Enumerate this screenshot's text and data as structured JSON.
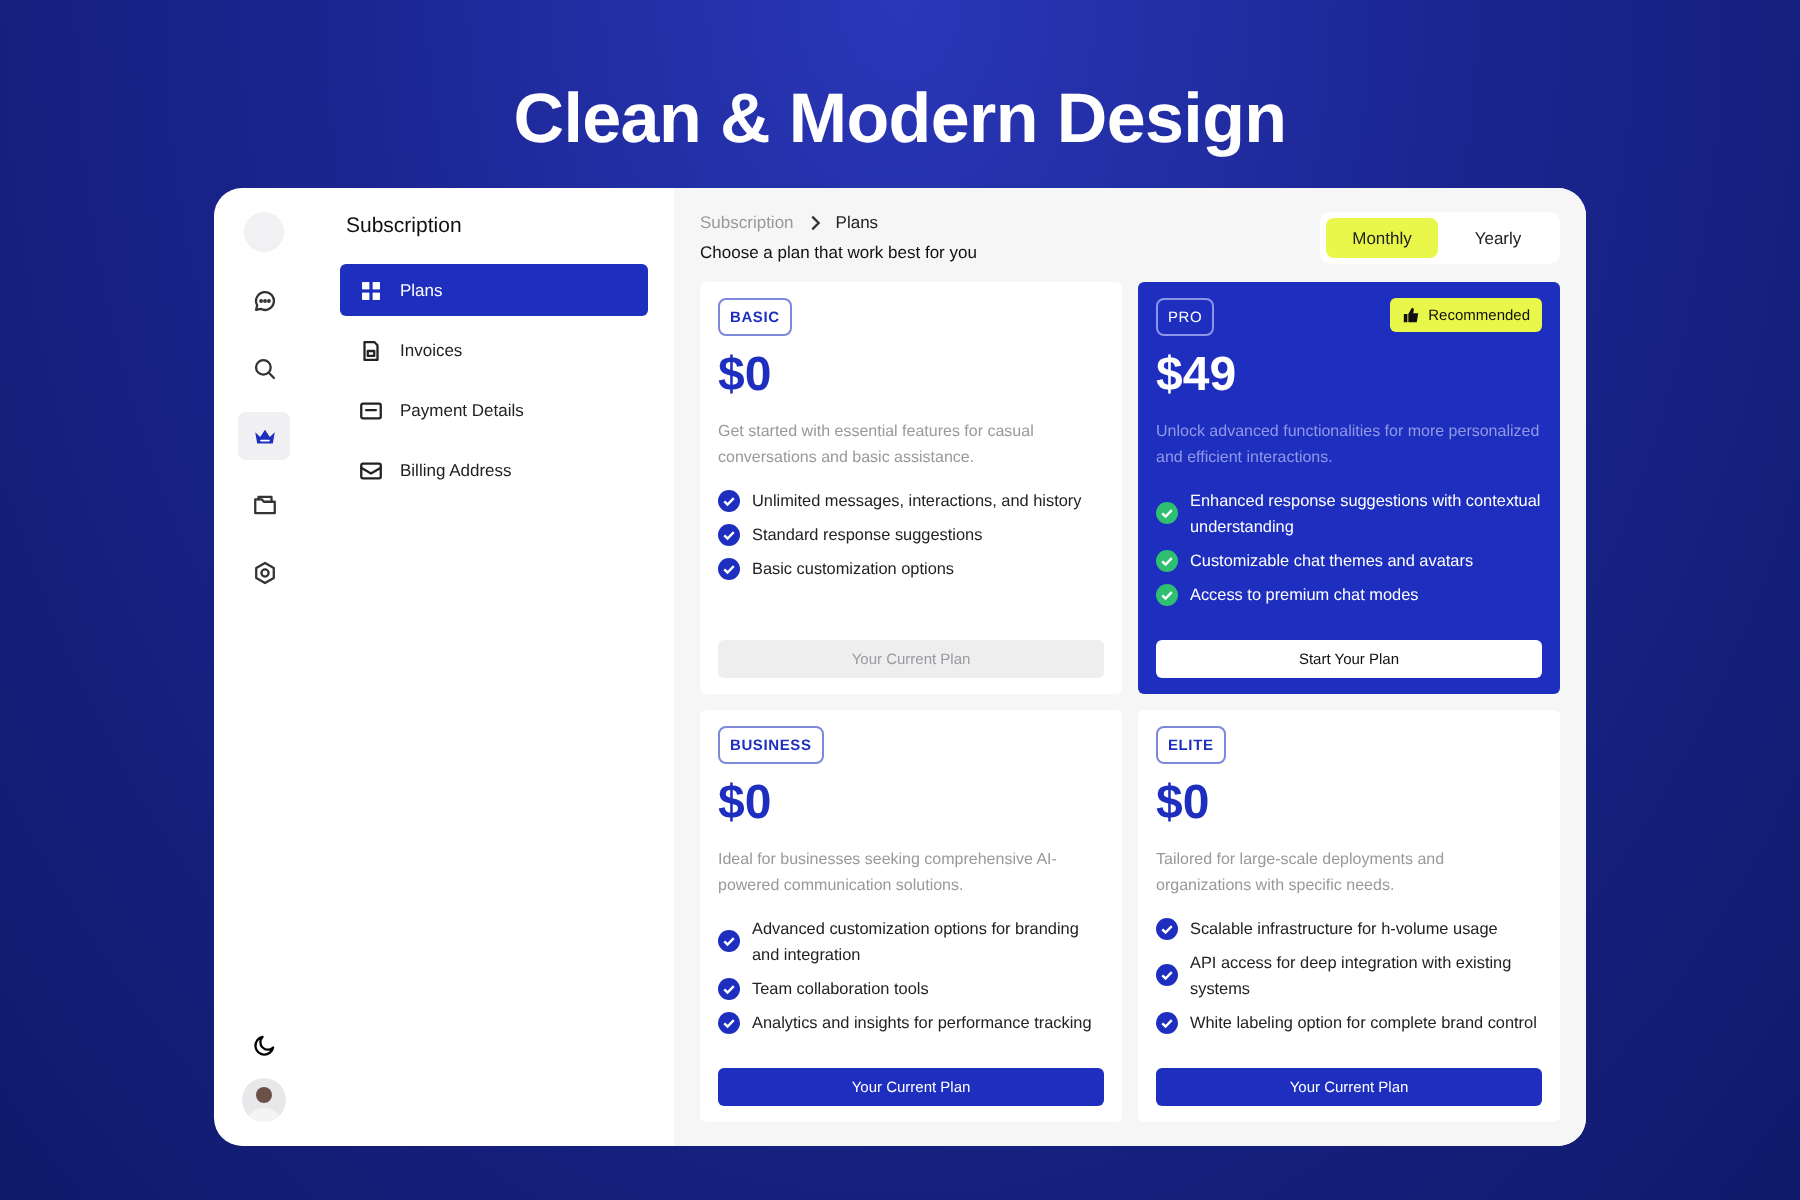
{
  "headline": "Clean & Modern Design",
  "rail": [
    {
      "kind": "blank",
      "selected": false
    },
    {
      "kind": "chat",
      "selected": false
    },
    {
      "kind": "search",
      "selected": false
    },
    {
      "kind": "crown",
      "selected": true
    },
    {
      "kind": "folder",
      "selected": false
    },
    {
      "kind": "settings",
      "selected": false
    }
  ],
  "rail_bottom": [
    {
      "kind": "moon"
    },
    {
      "kind": "avatar"
    }
  ],
  "sidebar": {
    "title": "Subscription",
    "items": [
      {
        "label": "Plans",
        "kind": "grid",
        "selected": true
      },
      {
        "label": "Invoices",
        "kind": "invoice",
        "selected": false
      },
      {
        "label": "Payment Details",
        "kind": "card",
        "selected": false
      },
      {
        "label": "Billing Address",
        "kind": "mail",
        "selected": false
      }
    ]
  },
  "breadcrumb": [
    "Subscription",
    "Plans"
  ],
  "subtitle": "Choose a plan that work best for you",
  "billing_toggle": [
    {
      "label": "Monthly",
      "selected": true
    },
    {
      "label": "Yearly",
      "selected": false
    }
  ],
  "plans": [
    {
      "tag": "BASIC",
      "featured": false,
      "price": "$0",
      "description": "Get started with essential features for casual conversations and basic assistance.",
      "features": [
        "Unlimited messages, interactions, and history",
        "Standard response suggestions",
        "Basic customization options"
      ],
      "button": {
        "label": "Your Current Plan",
        "kind": "muted"
      }
    },
    {
      "tag": "PRO",
      "featured": true,
      "badge": "Recommended",
      "price": "$49",
      "description": "Unlock advanced functionalities for more personalized and efficient interactions.",
      "features": [
        "Enhanced response suggestions with contextual understanding",
        "Customizable chat themes and avatars",
        "Access to premium chat modes"
      ],
      "button": {
        "label": "Start Your Plan",
        "kind": "light"
      }
    },
    {
      "tag": "BUSINESS",
      "featured": false,
      "price": "$0",
      "description": "Ideal for businesses seeking comprehensive AI-powered communication solutions.",
      "features": [
        "Advanced customization options for branding and integration",
        "Team collaboration tools",
        "Analytics and insights for performance tracking"
      ],
      "button": {
        "label": "Your Current Plan",
        "kind": "primary"
      }
    },
    {
      "tag": "ELITE",
      "featured": false,
      "price": "$0",
      "description": "Tailored for large-scale deployments and organizations with specific needs.",
      "features": [
        "Scalable infrastructure for h-volume usage",
        "API access for deep integration with existing systems",
        "White labeling option for complete brand control"
      ],
      "button": {
        "label": "Your Current Plan",
        "kind": "primary"
      }
    }
  ]
}
